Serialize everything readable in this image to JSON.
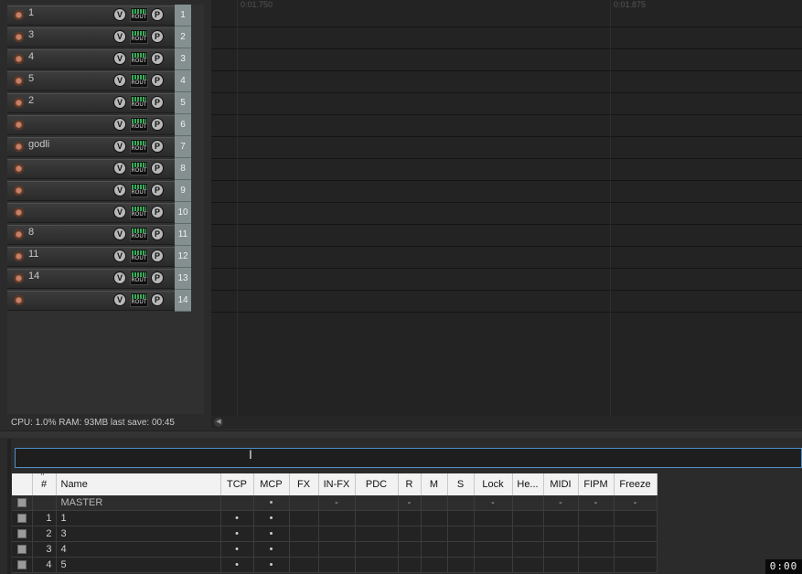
{
  "tracks": [
    {
      "name": "1",
      "number": "1"
    },
    {
      "name": "3",
      "number": "2"
    },
    {
      "name": "4",
      "number": "3"
    },
    {
      "name": "5",
      "number": "4"
    },
    {
      "name": "2",
      "number": "5"
    },
    {
      "name": "",
      "number": "6"
    },
    {
      "name": "godli",
      "number": "7"
    },
    {
      "name": "",
      "number": "8"
    },
    {
      "name": "",
      "number": "9"
    },
    {
      "name": "",
      "number": "10"
    },
    {
      "name": "8",
      "number": "11"
    },
    {
      "name": "11",
      "number": "12"
    },
    {
      "name": "14",
      "number": "13"
    },
    {
      "name": "",
      "number": "14"
    }
  ],
  "track_controls": {
    "volume": "V",
    "route": "ROUT",
    "pan": "P"
  },
  "status_bar": "CPU: 1.0%  RAM: 93MB  last save: 00:45",
  "ruler": {
    "mark1": "0:01.750",
    "mark2": "0:01.875"
  },
  "track_manager": {
    "filter_value": "",
    "columns": [
      "",
      "#",
      "Name",
      "TCP",
      "MCP",
      "FX",
      "IN-FX",
      "PDC",
      "R",
      "M",
      "S",
      "Lock",
      "He...",
      "MIDI",
      "FIPM",
      "Freeze"
    ],
    "rows": [
      {
        "num": "",
        "name": "MASTER",
        "tcp": "",
        "mcp": "•",
        "fx": "",
        "infx": "-",
        "pdc": "",
        "r": "-",
        "m": "",
        "s": "",
        "lock": "-",
        "he": "",
        "midi": "-",
        "fipm": "-",
        "freeze": "-"
      },
      {
        "num": "1",
        "name": "1",
        "tcp": "•",
        "mcp": "•",
        "fx": "",
        "infx": "",
        "pdc": "",
        "r": "",
        "m": "",
        "s": "",
        "lock": "",
        "he": "",
        "midi": "",
        "fipm": "",
        "freeze": ""
      },
      {
        "num": "2",
        "name": "3",
        "tcp": "•",
        "mcp": "•",
        "fx": "",
        "infx": "",
        "pdc": "",
        "r": "",
        "m": "",
        "s": "",
        "lock": "",
        "he": "",
        "midi": "",
        "fipm": "",
        "freeze": ""
      },
      {
        "num": "3",
        "name": "4",
        "tcp": "•",
        "mcp": "•",
        "fx": "",
        "infx": "",
        "pdc": "",
        "r": "",
        "m": "",
        "s": "",
        "lock": "",
        "he": "",
        "midi": "",
        "fipm": "",
        "freeze": ""
      },
      {
        "num": "4",
        "name": "5",
        "tcp": "•",
        "mcp": "•",
        "fx": "",
        "infx": "",
        "pdc": "",
        "r": "",
        "m": "",
        "s": "",
        "lock": "",
        "he": "",
        "midi": "",
        "fipm": "",
        "freeze": ""
      }
    ]
  },
  "timer": "0:00",
  "colors": {
    "track_number_bg": "#849090",
    "record_arm": "#a86e52",
    "filter_border": "#4e8ec8"
  }
}
